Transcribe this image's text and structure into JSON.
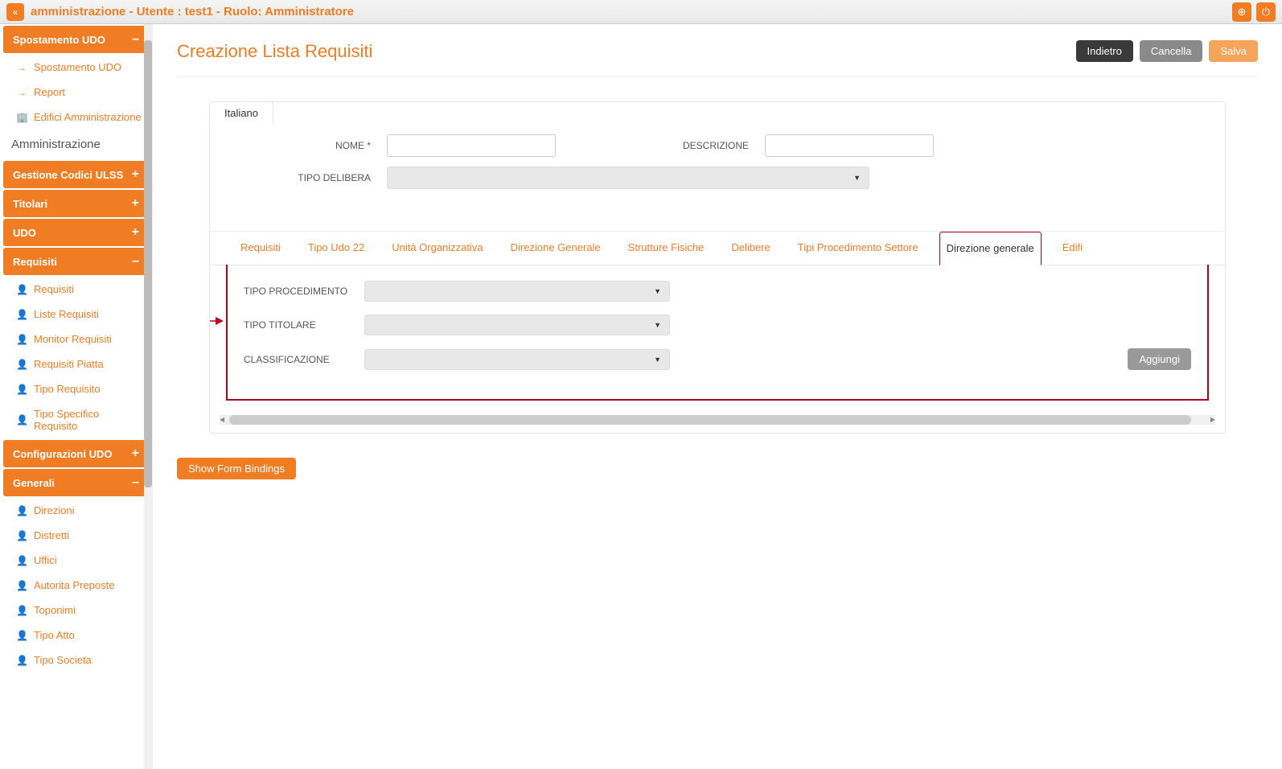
{
  "topbar": {
    "title": "amministrazione - Utente : test1 - Ruolo: Amministratore"
  },
  "sidebar": {
    "groups": [
      {
        "label": "Spostamento UDO",
        "toggle": "–",
        "items": [
          {
            "label": "Spostamento UDO",
            "icon": "arrow"
          }
        ]
      },
      {
        "plain_items": [
          {
            "label": "Report",
            "icon": "arrow"
          },
          {
            "label": "Edifici Amministrazione",
            "icon": "building"
          }
        ]
      },
      {
        "section_title": "Amministrazione"
      },
      {
        "label": "Gestione Codici ULSS",
        "toggle": "+"
      },
      {
        "label": "Titolari",
        "toggle": "+"
      },
      {
        "label": "UDO",
        "toggle": "+"
      },
      {
        "label": "Requisiti",
        "toggle": "–",
        "items": [
          {
            "label": "Requisiti",
            "icon": "user"
          },
          {
            "label": "Liste Requisiti",
            "icon": "user"
          },
          {
            "label": "Monitor Requisiti",
            "icon": "user"
          },
          {
            "label": "Requisiti Piatta",
            "icon": "user"
          },
          {
            "label": "Tipo Requisito",
            "icon": "user"
          },
          {
            "label": "Tipo Specifico Requisito",
            "icon": "user"
          }
        ]
      },
      {
        "label": "Configurazioni UDO",
        "toggle": "+"
      },
      {
        "label": "Generali",
        "toggle": "–",
        "items": [
          {
            "label": "Direzioni",
            "icon": "user"
          },
          {
            "label": "Distretti",
            "icon": "user"
          },
          {
            "label": "Uffici",
            "icon": "user"
          },
          {
            "label": "Autorita Preposte",
            "icon": "user"
          },
          {
            "label": "Toponimi",
            "icon": "user"
          },
          {
            "label": "Tipo Atto",
            "icon": "user"
          },
          {
            "label": "Tipo Societa",
            "icon": "user"
          }
        ]
      }
    ]
  },
  "page": {
    "title": "Creazione Lista Requisiti",
    "actions": {
      "back": "Indietro",
      "cancel": "Cancella",
      "save": "Salva"
    },
    "lang_tab": "Italiano",
    "form": {
      "nome_label": "NOME *",
      "descrizione_label": "DESCRIZIONE",
      "tipo_delibera_label": "TIPO DELIBERA"
    },
    "tabs": [
      "Requisiti",
      "Tipo Udo 22",
      "Unità Organizzativa",
      "Direzione Generale",
      "Strutture Fisiche",
      "Delibere",
      "Tipi Procedimento Settore",
      "Direzione generale",
      "Edifi"
    ],
    "active_tab_index": 7,
    "panel": {
      "tipo_procedimento": "TIPO PROCEDIMENTO",
      "tipo_titolare": "TIPO TITOLARE",
      "classificazione": "CLASSIFICAZIONE",
      "aggiungi": "Aggiungi"
    },
    "debug_btn": "Show Form Bindings"
  }
}
